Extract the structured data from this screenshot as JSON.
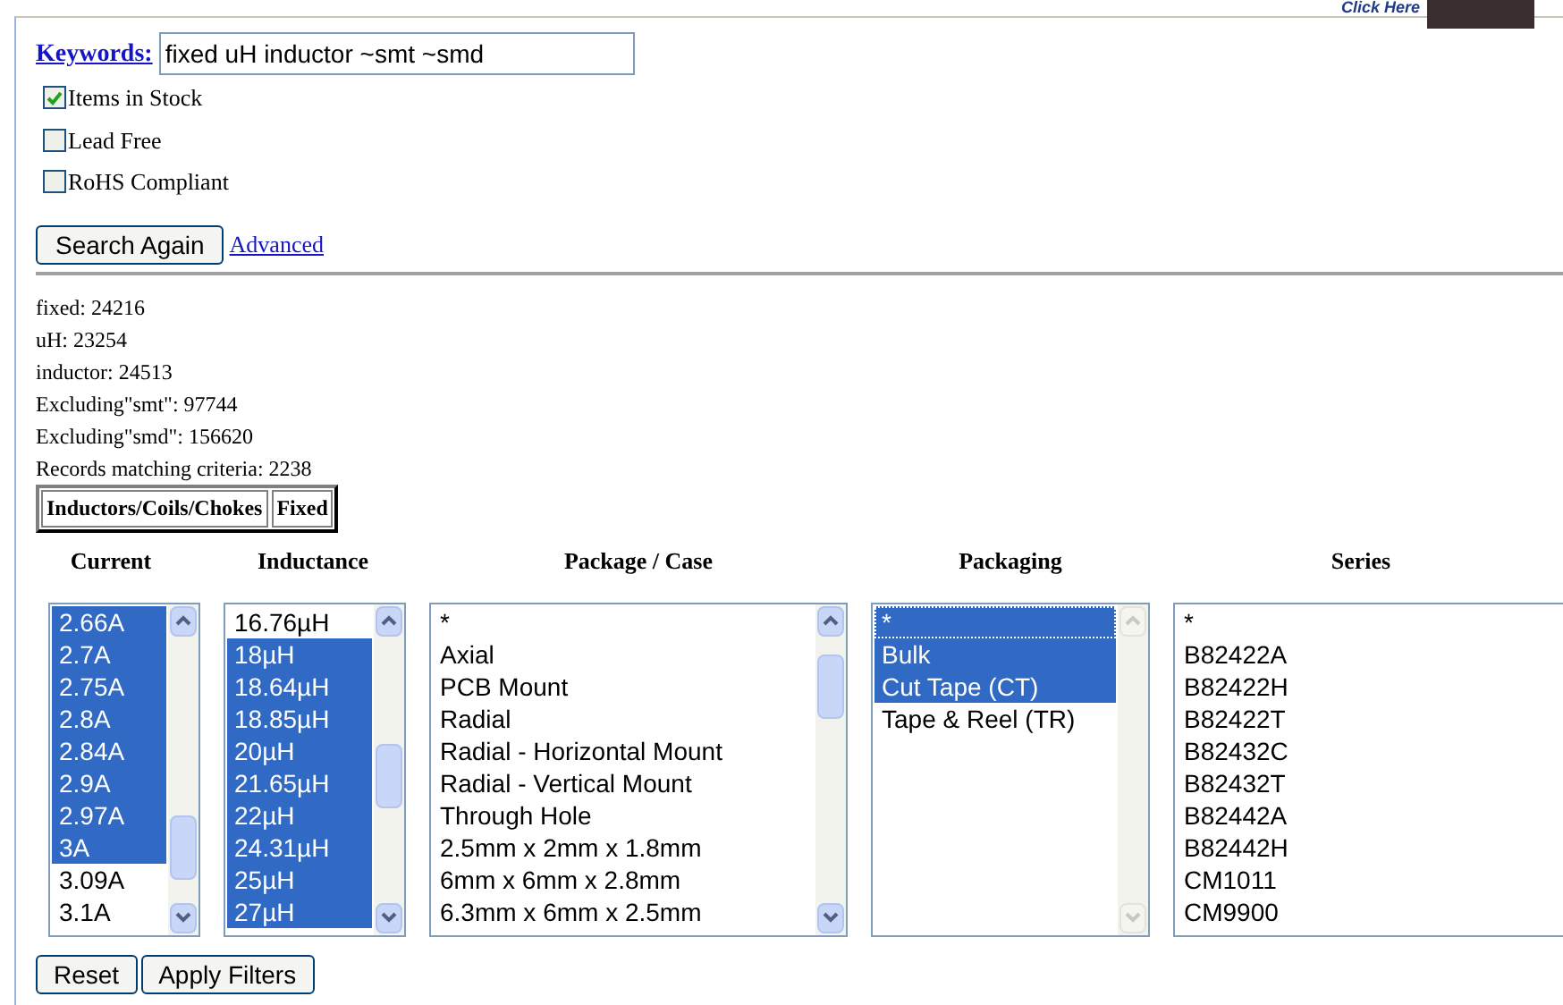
{
  "banner": {
    "text": "Click Here"
  },
  "search": {
    "label": "Keywords:",
    "value": "fixed uH inductor ~smt ~smd"
  },
  "options": [
    {
      "label": "Items in Stock",
      "checked": true
    },
    {
      "label": "Lead Free",
      "checked": false
    },
    {
      "label": "RoHS Compliant",
      "checked": false
    }
  ],
  "buttons": [
    "Search Again"
  ],
  "advanced_link": "Advanced",
  "counts": [
    "fixed: 24216",
    "uH: 23254",
    "inductor: 24513",
    "Excluding\"smt\": 97744",
    "Excluding\"smd\": 156620",
    "Records matching criteria: 2238"
  ],
  "breadcrumb": [
    "Inductors/Coils/Chokes",
    "Fixed"
  ],
  "filters": [
    {
      "heading": "Current",
      "items": [
        {
          "label": "2.66A",
          "selected": true
        },
        {
          "label": "2.7A",
          "selected": true
        },
        {
          "label": "2.75A",
          "selected": true
        },
        {
          "label": "2.8A",
          "selected": true
        },
        {
          "label": "2.84A",
          "selected": true
        },
        {
          "label": "2.9A",
          "selected": true
        },
        {
          "label": "2.97A",
          "selected": true
        },
        {
          "label": "3A",
          "selected": true
        },
        {
          "label": "3.09A",
          "selected": false
        },
        {
          "label": "3.1A",
          "selected": false
        }
      ]
    },
    {
      "heading": "Inductance",
      "items": [
        {
          "label": "16.76µH",
          "selected": false
        },
        {
          "label": "18µH",
          "selected": true
        },
        {
          "label": "18.64µH",
          "selected": true
        },
        {
          "label": "18.85µH",
          "selected": true
        },
        {
          "label": "20µH",
          "selected": true
        },
        {
          "label": "21.65µH",
          "selected": true
        },
        {
          "label": "22µH",
          "selected": true
        },
        {
          "label": "24.31µH",
          "selected": true
        },
        {
          "label": "25µH",
          "selected": true
        },
        {
          "label": "27µH",
          "selected": true
        }
      ]
    },
    {
      "heading": "Package / Case",
      "items": [
        {
          "label": "*",
          "selected": false
        },
        {
          "label": "Axial",
          "selected": false
        },
        {
          "label": "PCB Mount",
          "selected": false
        },
        {
          "label": "Radial",
          "selected": false
        },
        {
          "label": "Radial - Horizontal Mount",
          "selected": false
        },
        {
          "label": "Radial - Vertical Mount",
          "selected": false
        },
        {
          "label": "Through Hole",
          "selected": false
        },
        {
          "label": "2.5mm x 2mm x 1.8mm",
          "selected": false
        },
        {
          "label": "6mm x 6mm x 2.8mm",
          "selected": false
        },
        {
          "label": "6.3mm x 6mm x 2.5mm",
          "selected": false
        }
      ]
    },
    {
      "heading": "Packaging",
      "disabled_scroll": true,
      "items": [
        {
          "label": "*",
          "selected": true,
          "focused": true
        },
        {
          "label": "Bulk",
          "selected": true
        },
        {
          "label": "Cut Tape (CT)",
          "selected": true
        },
        {
          "label": "Tape & Reel (TR)",
          "selected": false
        }
      ]
    },
    {
      "heading": "Series",
      "items": [
        {
          "label": "*",
          "selected": false
        },
        {
          "label": "B82422A",
          "selected": false
        },
        {
          "label": "B82422H",
          "selected": false
        },
        {
          "label": "B82422T",
          "selected": false
        },
        {
          "label": "B82432C",
          "selected": false
        },
        {
          "label": "B82432T",
          "selected": false
        },
        {
          "label": "B82442A",
          "selected": false
        },
        {
          "label": "B82442H",
          "selected": false
        },
        {
          "label": "CM1011",
          "selected": false
        },
        {
          "label": "CM9900",
          "selected": false
        }
      ]
    }
  ],
  "filter_buttons": [
    "Reset",
    "Apply Filters"
  ]
}
